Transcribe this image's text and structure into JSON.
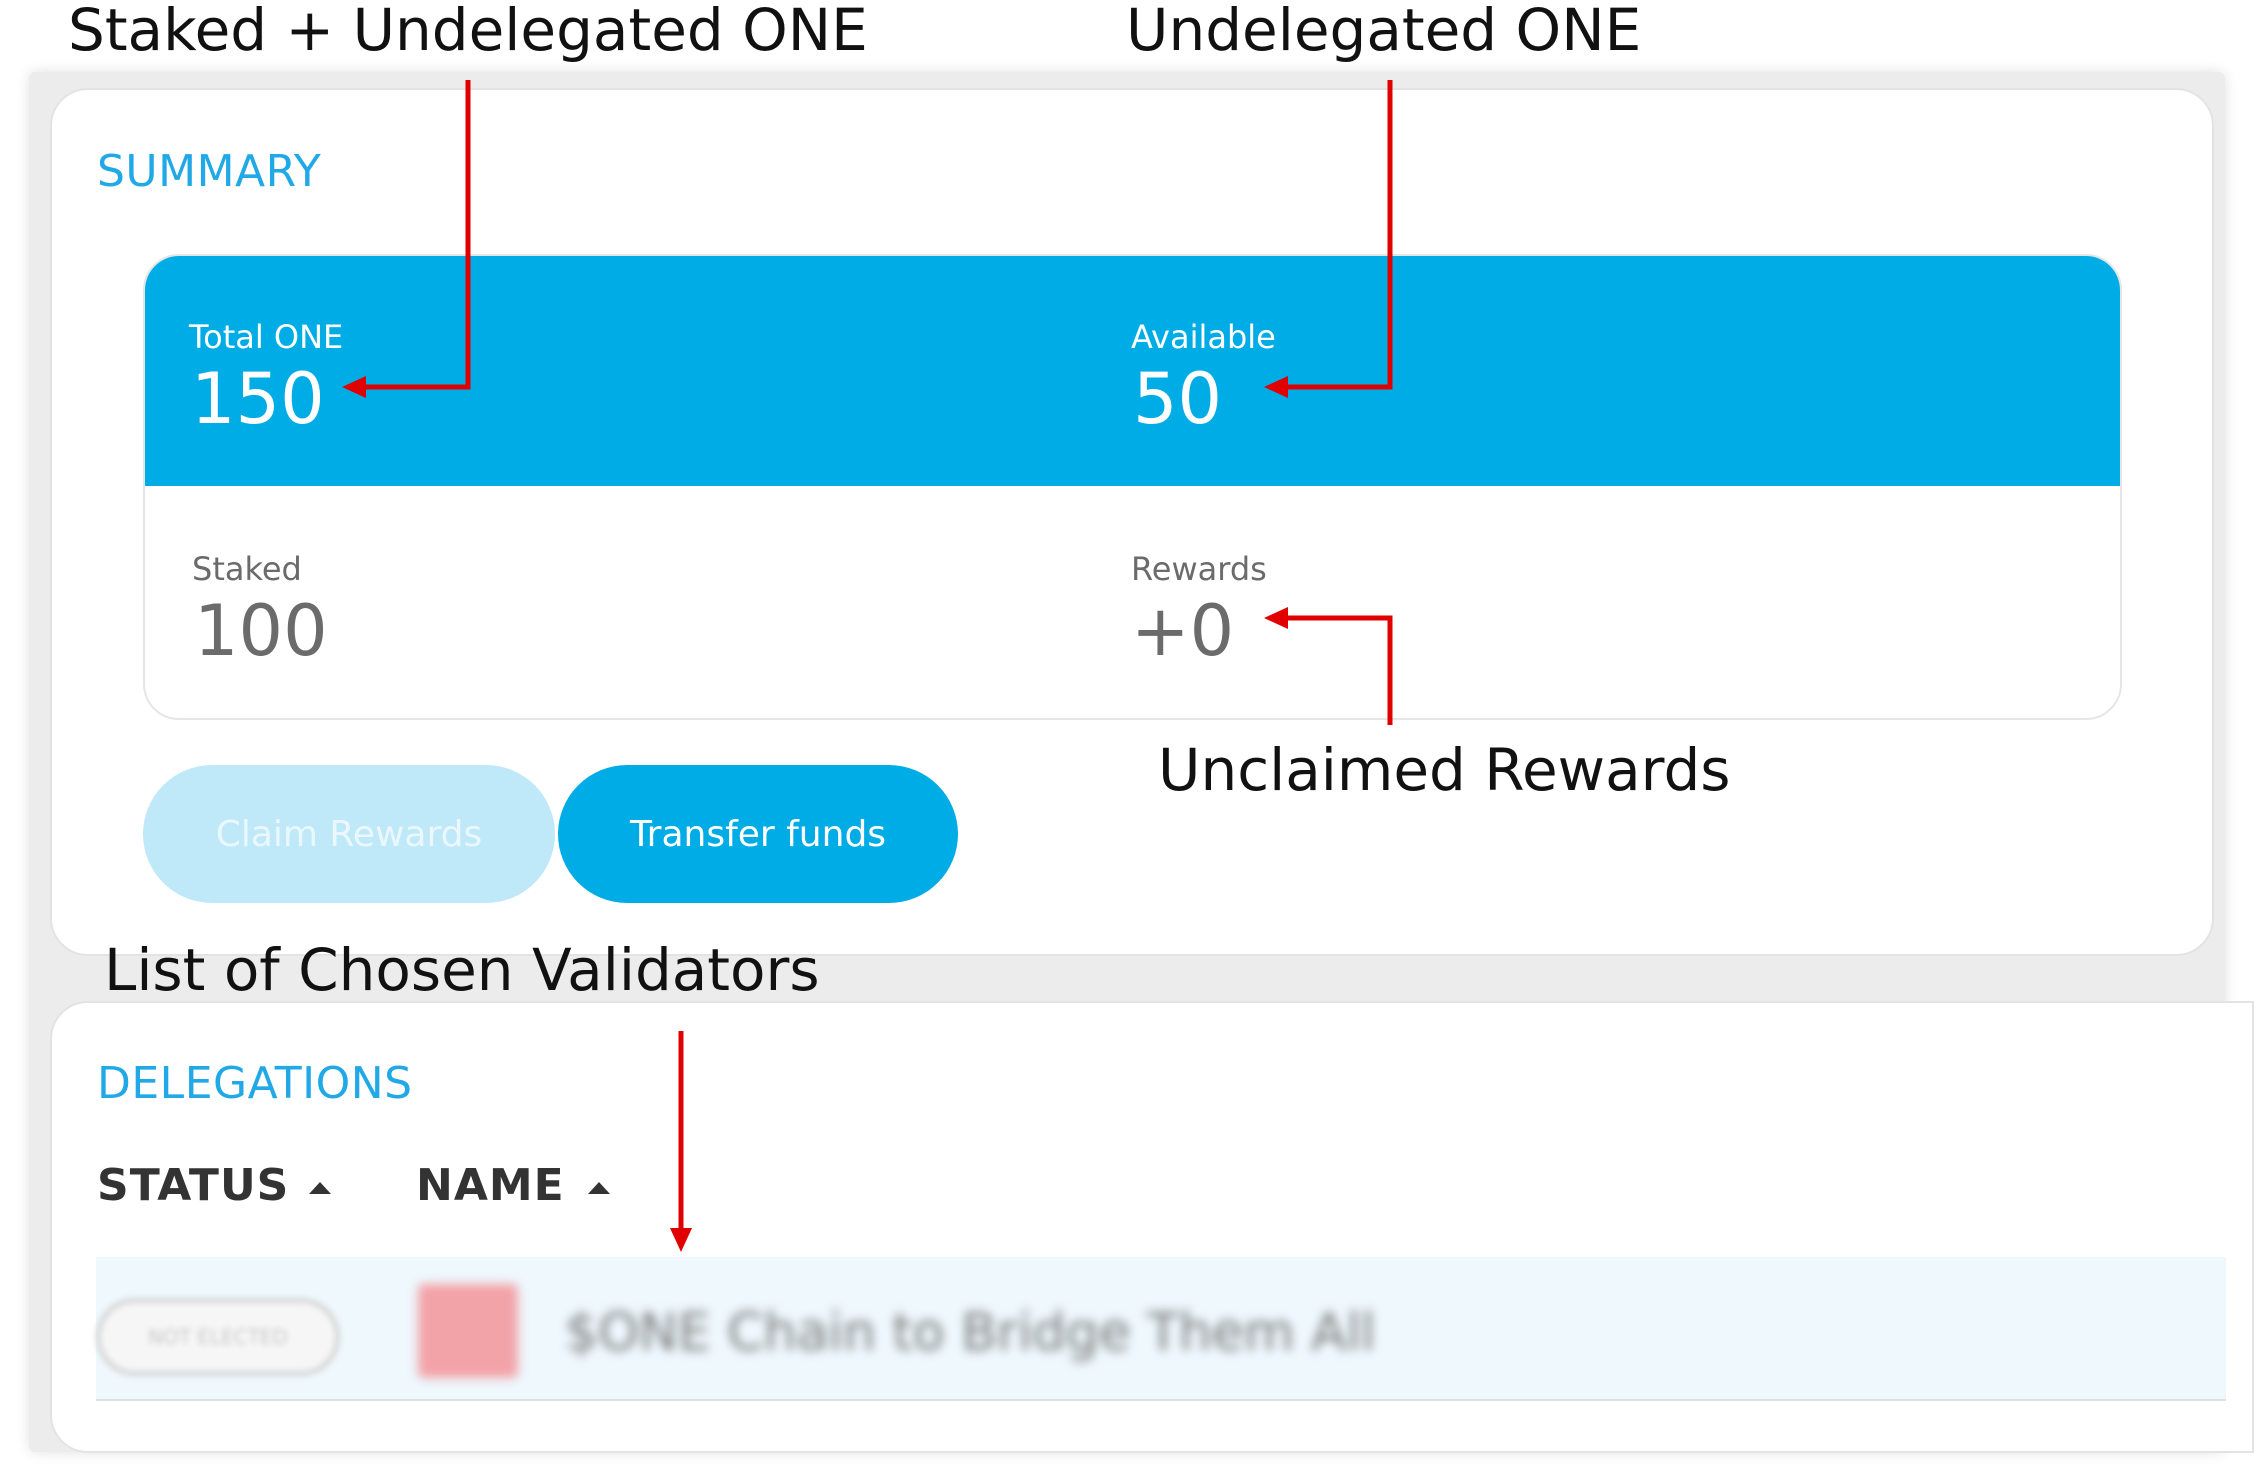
{
  "annotations": {
    "staked_plus_undelegated": "Staked + Undelegated ONE",
    "undelegated": "Undelegated ONE",
    "unclaimed_rewards": "Unclaimed Rewards",
    "chosen_validators": "List of Chosen Validators"
  },
  "summary": {
    "title": "SUMMARY",
    "total_label": "Total ONE",
    "total_value": "150",
    "available_label": "Available",
    "available_value": "50",
    "staked_label": "Staked",
    "staked_value": "100",
    "rewards_label": "Rewards",
    "rewards_value": "+0",
    "claim_button": "Claim Rewards",
    "transfer_button": "Transfer funds"
  },
  "delegations": {
    "title": "DELEGATIONS",
    "columns": [
      "STATUS",
      "NAME"
    ],
    "rows": [
      {
        "status": "NOT ELECTED",
        "name": "$ONE Chain to Bridge Them All"
      }
    ]
  },
  "colors": {
    "accent": "#00ace6",
    "arrow": "#e00000"
  }
}
